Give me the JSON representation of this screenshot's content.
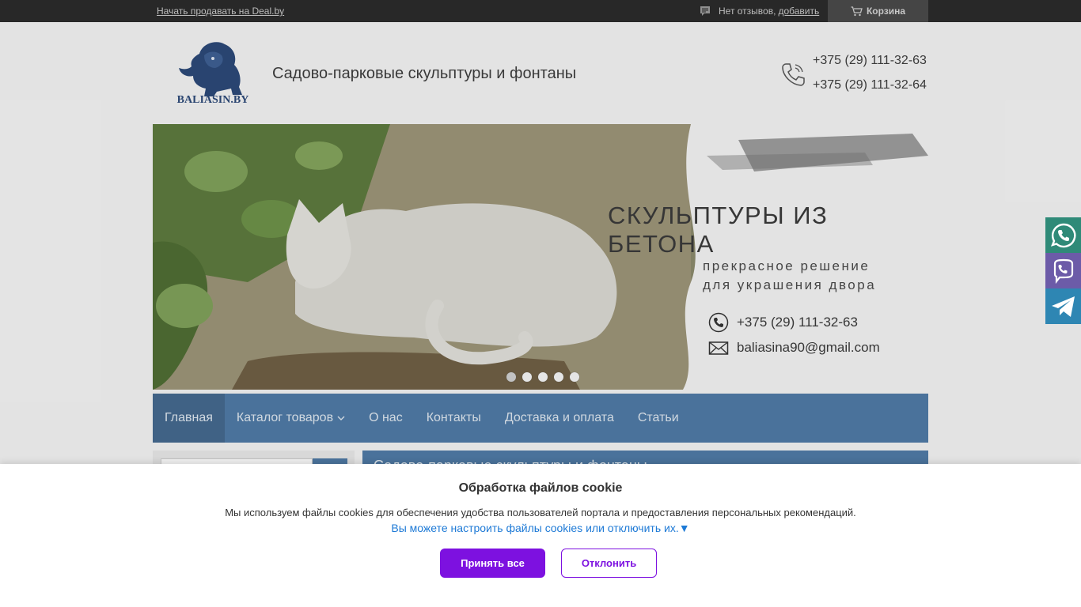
{
  "topbar": {
    "sell_link": "Начать продавать на Deal.by",
    "reviews_text": "Нет отзывов,",
    "reviews_add": "добавить",
    "cart_label": "Корзина"
  },
  "header": {
    "logo_text": "BALIASIN.BY",
    "title": "Садово-парковые скульптуры и фонтаны",
    "phones": [
      "+375 (29) 111-32-63",
      "+375 (29) 111-32-64"
    ]
  },
  "banner": {
    "title": "СКУЛЬПТУРЫ ИЗ БЕТОНА",
    "subtitle_1": "прекрасное решение",
    "subtitle_2": "для украшения двора",
    "phone": "+375 (29) 111-32-63",
    "email": "baliasina90@gmail.com",
    "slides_count": 5,
    "active_slide": 1
  },
  "nav": {
    "items": [
      {
        "label": "Главная"
      },
      {
        "label": "Каталог товаров"
      },
      {
        "label": "О нас"
      },
      {
        "label": "Контакты"
      },
      {
        "label": "Доставка и оплата"
      },
      {
        "label": "Статьи"
      }
    ]
  },
  "main": {
    "heading": "Садово-парковые скульптуры и фонтаны"
  },
  "messengers": [
    "whatsapp-icon",
    "viber-icon",
    "telegram-icon"
  ],
  "cookie": {
    "title": "Обработка файлов cookie",
    "text": "Мы используем файлы cookies для обеспечения удобства пользователей портала и предоставления персональных рекомендаций.",
    "settings_link": "Вы можете настроить файлы cookies или отключить их.▼",
    "accept_label": "Принять все",
    "decline_label": "Отклонить"
  },
  "colors": {
    "topbar": "#2b2b2b",
    "nav": "#4f7aa5",
    "accent_purple": "#7d11e0",
    "link_blue": "#1e7ad6"
  }
}
